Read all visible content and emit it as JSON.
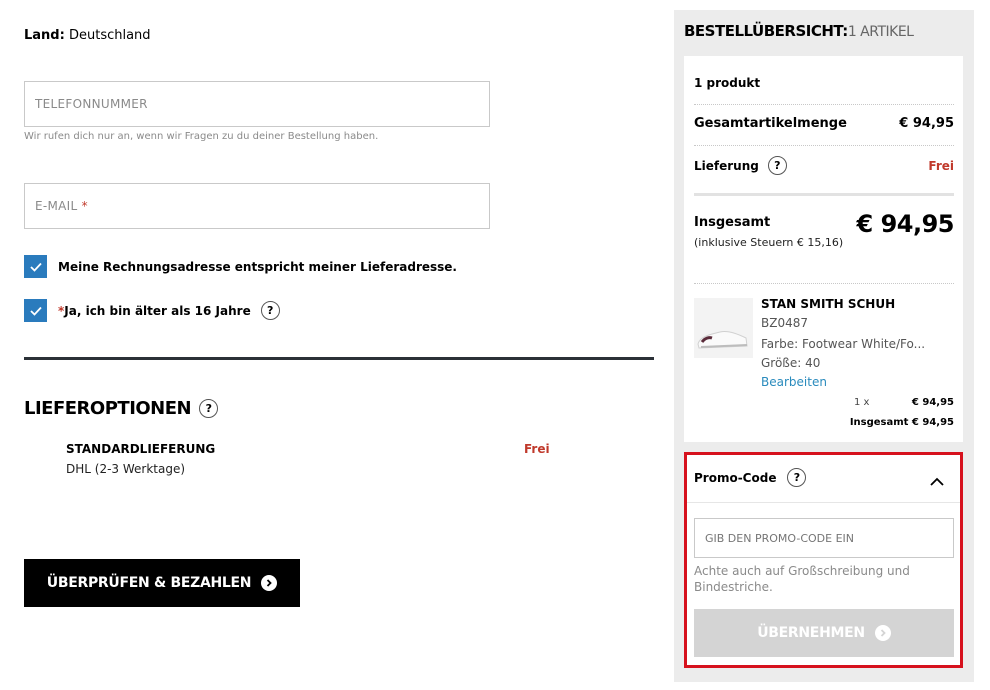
{
  "form": {
    "country_label": "Land:",
    "country_value": "Deutschland",
    "phone_placeholder": "TELEFONNUMMER",
    "phone_hint": "Wir rufen dich nur an, wenn wir Fragen zu du deiner Bestellung haben.",
    "email_placeholder": "E-MAIL",
    "email_required_mark": "*",
    "billing_same_label": "Meine Rechnungsadresse entspricht meiner Lieferadresse.",
    "age_required_mark": "*",
    "age_label": "Ja, ich bin älter als 16 Jahre"
  },
  "delivery": {
    "title": "LIEFEROPTIONEN",
    "option_name": "STANDARDLIEFERUNG",
    "option_detail": "DHL (2-3 Werktage)",
    "option_price": "Frei"
  },
  "pay_button_label": "ÜBERPRÜFEN & BEZAHLEN",
  "summary": {
    "title": "BESTELLÜBERSICHT:",
    "count": "1 ARTIKEL",
    "products_count": "1 produkt",
    "subtotal_label": "Gesamtartikelmenge",
    "subtotal_value": "€ 94,95",
    "shipping_label": "Lieferung",
    "shipping_value": "Frei",
    "total_label": "Insgesamt",
    "total_tax": "(inklusive Steuern  € 15,16)",
    "total_value": "€ 94,95"
  },
  "product": {
    "name": "STAN SMITH SCHUH",
    "sku": "BZ0487",
    "color": "Farbe: Footwear White/Fo...",
    "size": "Größe: 40",
    "edit_link": "Bearbeiten",
    "qty": "1 x",
    "unit_price": "€ 94,95",
    "line_total": "Insgesamt € 94,95"
  },
  "promo": {
    "title": "Promo-Code",
    "input_placeholder": "GIB DEN PROMO-CODE EIN",
    "hint": "Achte auch auf Großschreibung und Bindestriche.",
    "apply_label": "ÜBERNEHMEN"
  },
  "colors": {
    "accent_blue": "#2a7bbd",
    "price_red": "#c0392b",
    "highlight_red": "#d6111d"
  }
}
